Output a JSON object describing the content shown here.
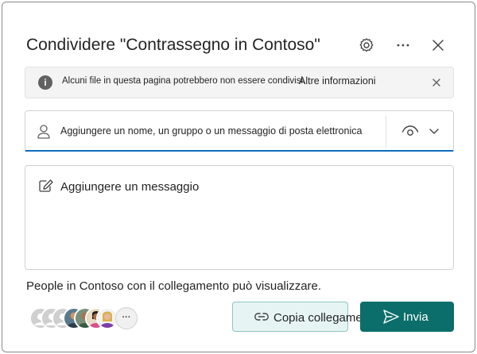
{
  "dialog": {
    "title": "Condividere \"Contrassegno in Contoso\"",
    "header_icons": [
      "gear-icon",
      "more-icon",
      "close-icon"
    ]
  },
  "banner": {
    "message": "Alcuni file in questa pagina potrebbero non essere condivisi.",
    "link": "Altre informazioni"
  },
  "people_picker": {
    "placeholder": "Aggiungere un nome, un gruppo o un messaggio di posta elettronica",
    "permission_icon": "eye-icon"
  },
  "message_box": {
    "placeholder": "Aggiungere un messaggio"
  },
  "link_scope": {
    "text": "People in Contoso con il collegamento può visualizzare."
  },
  "avatars": {
    "more": "···"
  },
  "actions": {
    "copy_label": "Copia collegamento",
    "send_label": "Invia"
  },
  "colors": {
    "accent_focus": "#0f6cbd",
    "send_bg": "#0c6e6a",
    "copy_bg": "#e6f5f4",
    "copy_border": "#8fc4c0"
  }
}
